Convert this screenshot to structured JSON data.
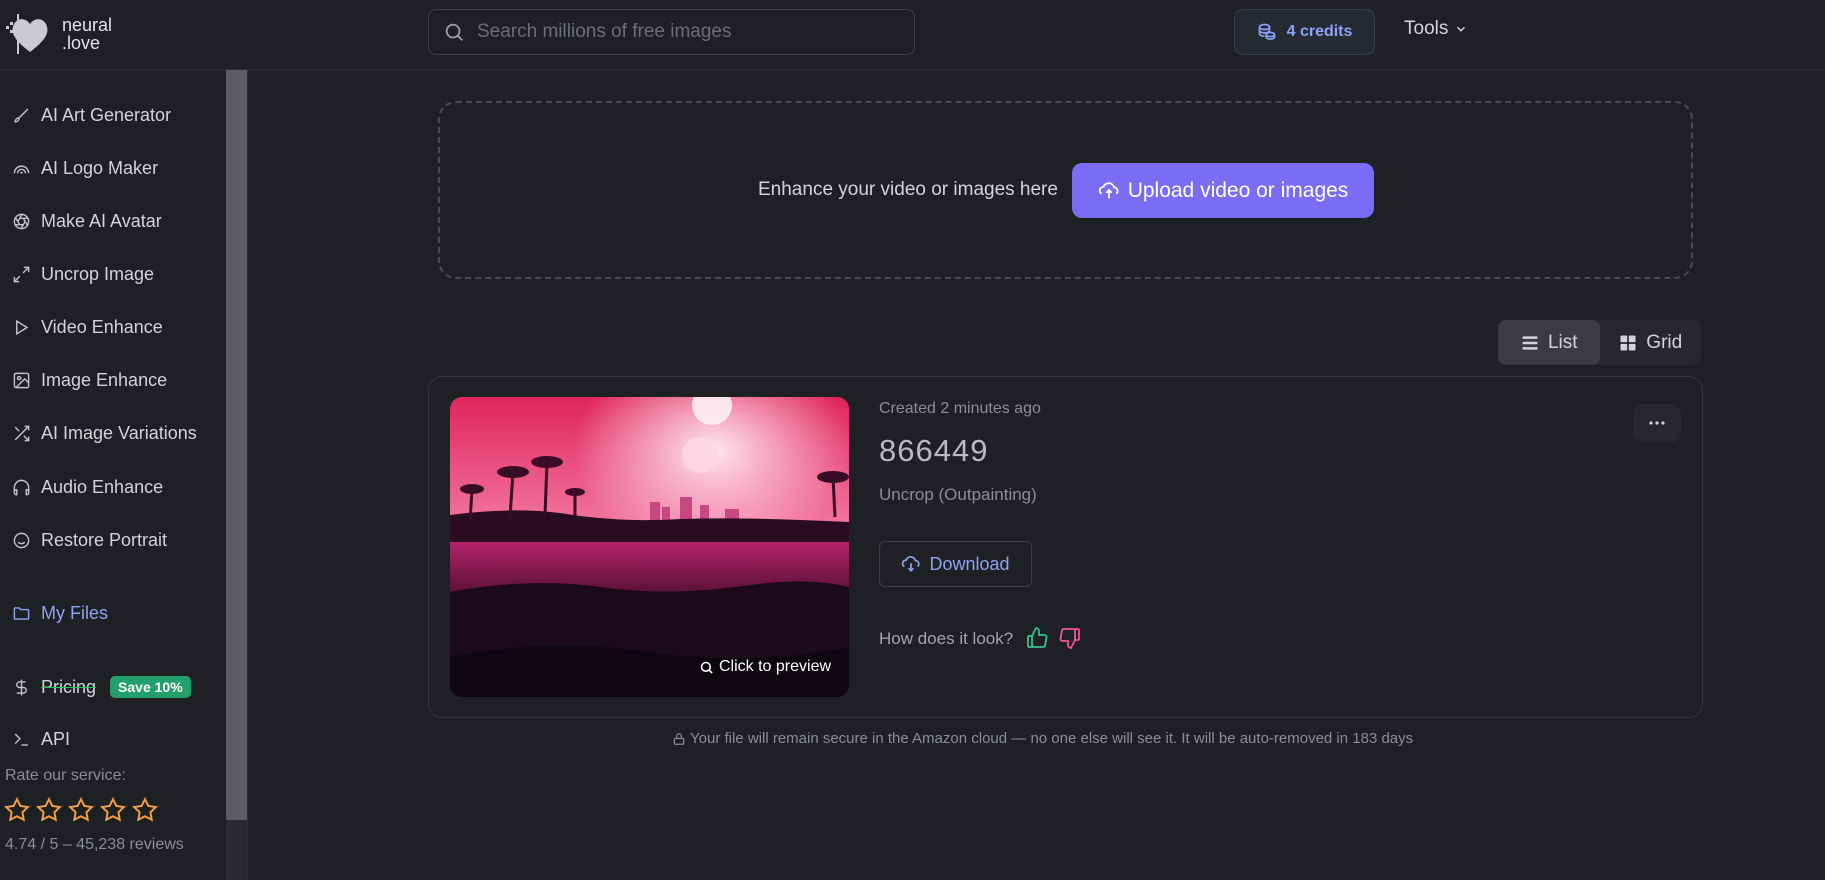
{
  "brand": {
    "name_line1": "neural",
    "name_line2": ".love"
  },
  "search": {
    "placeholder": "Search millions of free images"
  },
  "header": {
    "credits": "4 credits",
    "tools": "Tools"
  },
  "sidebar": {
    "items": [
      {
        "label": "AI Art Generator",
        "icon": "brush-icon"
      },
      {
        "label": "AI Logo Maker",
        "icon": "rainbow-icon"
      },
      {
        "label": "Make AI Avatar",
        "icon": "aperture-icon"
      },
      {
        "label": "Uncrop Image",
        "icon": "expand-icon"
      },
      {
        "label": "Video Enhance",
        "icon": "play-icon"
      },
      {
        "label": "Image Enhance",
        "icon": "image-icon"
      },
      {
        "label": "AI Image Variations",
        "icon": "shuffle-icon"
      },
      {
        "label": "Audio Enhance",
        "icon": "headphones-icon"
      },
      {
        "label": "Restore Portrait",
        "icon": "smile-icon"
      }
    ],
    "my_files": "My Files",
    "pricing": "Pricing",
    "pricing_badge": "Save 10%",
    "api": "API",
    "rate_label": "Rate our service:",
    "rating_summary": "4.74 / 5 – 45,238 reviews"
  },
  "upload": {
    "prompt": "Enhance your video or images here",
    "button": "Upload video or images"
  },
  "view_toggle": {
    "list": "List",
    "grid": "Grid",
    "active": "list"
  },
  "file": {
    "created": "Created 2 minutes ago",
    "id": "866449",
    "type": "Uncrop (Outpainting)",
    "download": "Download",
    "feedback_question": "How does it look?",
    "preview_label": "Click to preview"
  },
  "secure_note": "Your file will remain secure in the Amazon cloud — no one else will see it. It will be auto-removed in 183 days",
  "colors": {
    "accent": "#7b6cf6",
    "link": "#8ea2f4",
    "success": "#22a06b",
    "star": "#f0a14a"
  }
}
